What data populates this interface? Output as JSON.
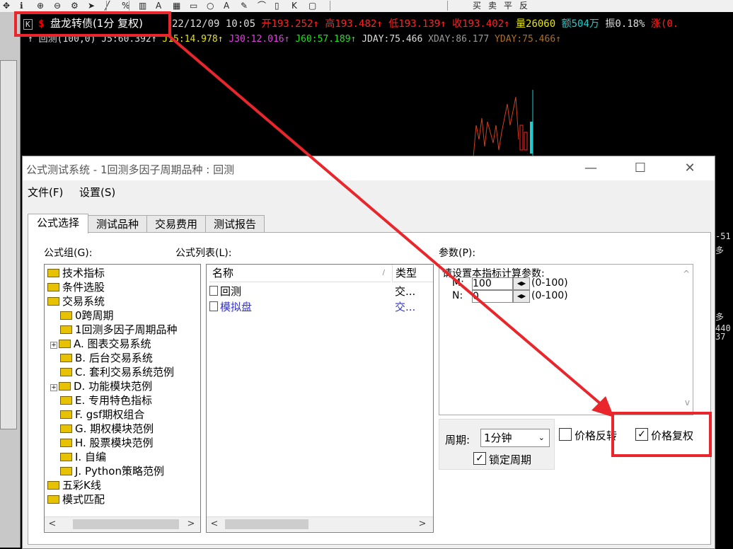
{
  "toolbar": {
    "buttons": [
      "move-icon",
      "info-icon",
      "zoom-in-icon",
      "zoom-out-icon",
      "gear-icon",
      "pointer-icon",
      "line-icon",
      "percent-icon",
      "bar-icon",
      "text-a-icon",
      "grid-icon",
      "rect-icon",
      "circle-icon",
      "text-icon",
      "pen-icon",
      "brush-icon",
      "ruler-icon",
      "k-icon",
      "window-icon"
    ],
    "right_labels": [
      "买",
      "卖",
      "平",
      "反"
    ]
  },
  "quote": {
    "k_label": "K",
    "name": "盘龙转债(1分 复权)",
    "datetime": "22/12/09 10:05",
    "open": "开193.252",
    "high": "高193.482",
    "low": "低193.139",
    "close": "收193.402",
    "volume": "量26060",
    "amount": "额504万",
    "amplitude": "振0.18%",
    "change": "涨(0.",
    "indicator_name": "回测(100,0)",
    "j5": "J5:60.392",
    "j15": "J15:14.978",
    "j30": "J30:12.016",
    "j60": "J60:57.189",
    "jday": "JDAY:75.466",
    "xday": "XDAY:86.177",
    "yday": "YDAY:75.466",
    "side_labels": [
      "-51",
      "多",
      "多",
      "440",
      "37"
    ]
  },
  "dialog": {
    "title": "公式测试系统 - 1回测多因子周期品种 : 回测",
    "menu": [
      "文件(F)",
      "设置(S)"
    ],
    "tabs": [
      "公式选择",
      "测试品种",
      "交易费用",
      "测试报告"
    ],
    "group_label": "公式组(G):",
    "list_label": "公式列表(L):",
    "param_label": "参数(P):",
    "tree": [
      {
        "label": "技术指标",
        "indent": 0,
        "expand": false
      },
      {
        "label": "条件选股",
        "indent": 0,
        "expand": false
      },
      {
        "label": "交易系统",
        "indent": 0,
        "expand": false
      },
      {
        "label": "0跨周期",
        "indent": 1,
        "expand": false
      },
      {
        "label": "1回测多因子周期品种",
        "indent": 1,
        "expand": false
      },
      {
        "label": "A. 图表交易系统",
        "indent": 1,
        "expand": true
      },
      {
        "label": "B. 后台交易系统",
        "indent": 1,
        "expand": false
      },
      {
        "label": "C. 套利交易系统范例",
        "indent": 1,
        "expand": false
      },
      {
        "label": "D. 功能模块范例",
        "indent": 1,
        "expand": true
      },
      {
        "label": "E. 专用特色指标",
        "indent": 1,
        "expand": false
      },
      {
        "label": "F. gsf期权组合",
        "indent": 1,
        "expand": false
      },
      {
        "label": "G. 期权模块范例",
        "indent": 1,
        "expand": false
      },
      {
        "label": "H. 股票模块范例",
        "indent": 1,
        "expand": false
      },
      {
        "label": "I. 自编",
        "indent": 1,
        "expand": false
      },
      {
        "label": "J. Python策略范例",
        "indent": 1,
        "expand": false
      },
      {
        "label": "五彩K线",
        "indent": 0,
        "expand": false
      },
      {
        "label": "模式匹配",
        "indent": 0,
        "expand": false
      }
    ],
    "list_headers": [
      "名称",
      "类型"
    ],
    "list_rows": [
      {
        "name": "回测",
        "type": "交...",
        "color": "#000"
      },
      {
        "name": "模拟盘",
        "type": "交...",
        "color": "#3333cc"
      }
    ],
    "params_hint": "请设置本指标计算参数:",
    "params": [
      {
        "name": "M:",
        "value": "100",
        "range": "(0-100)"
      },
      {
        "name": "N:",
        "value": "0",
        "range": "(0-100)"
      }
    ],
    "period_label": "周期:",
    "period_value": "1分钟",
    "lock_period_label": "锁定周期",
    "price_reverse_label": "价格反转",
    "price_restore_label": "价格复权",
    "lock_period_checked": true,
    "price_reverse_checked": false,
    "price_restore_checked": true
  },
  "annotation_color": "#e8262b"
}
